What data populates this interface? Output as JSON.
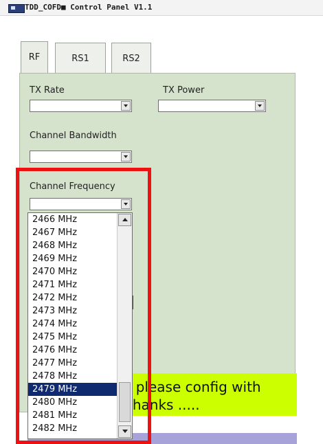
{
  "window": {
    "title": "TDD_COFD■ Control Panel V1.1"
  },
  "tabs": [
    {
      "label": "RF",
      "active": true
    },
    {
      "label": "RS1",
      "active": false
    },
    {
      "label": "RS2",
      "active": false
    }
  ],
  "rf": {
    "tx_rate_label": "TX Rate",
    "tx_rate_value": "",
    "tx_power_label": "TX Power",
    "tx_power_value": "",
    "channel_bandwidth_label": "Channel Bandwidth",
    "channel_bandwidth_value": "",
    "channel_frequency_label": "Channel Frequency",
    "channel_frequency_value": ""
  },
  "dropdown": {
    "options": [
      "2466 MHz",
      "2467 MHz",
      "2468 MHz",
      "2469 MHz",
      "2470 MHz",
      "2471 MHz",
      "2472 MHz",
      "2473 MHz",
      "2474 MHz",
      "2475 MHz",
      "2476 MHz",
      "2477 MHz",
      "2478 MHz",
      "2479 MHz",
      "2480 MHz",
      "2481 MHz",
      "2482 MHz"
    ],
    "selected": "2479 MHz"
  },
  "message": {
    "line1": ", please config with",
    "line2": "thanks ....."
  },
  "colors": {
    "panel_bg": "#d6e3cc",
    "highlight_selected": "#0f2a6e",
    "message_bg": "#ccff00",
    "annotation_border": "#ee1111",
    "bottom_bar": "#a7a2d7"
  }
}
